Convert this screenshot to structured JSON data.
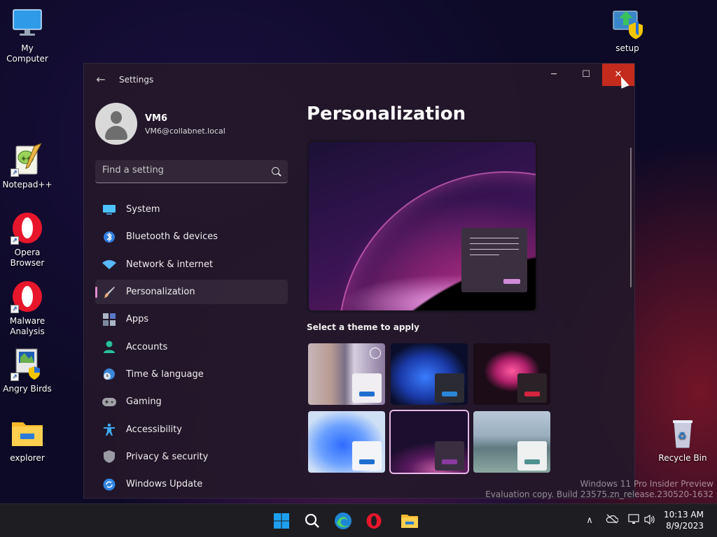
{
  "desktop": {
    "icons": [
      {
        "label": "My Computer",
        "icon": "monitor-icon"
      },
      {
        "label": "setup",
        "icon": "setup-icon"
      },
      {
        "label": "Notepad++",
        "icon": "notepad-plus-plus-icon"
      },
      {
        "label": "Opera Browser",
        "icon": "opera-icon"
      },
      {
        "label": "Malware Analysis",
        "icon": "opera-icon"
      },
      {
        "label": "Angry Birds",
        "icon": "installer-icon"
      },
      {
        "label": "explorer",
        "icon": "folder-icon"
      },
      {
        "label": "Recycle Bin",
        "icon": "recycle-bin-icon"
      }
    ]
  },
  "window": {
    "title": "Settings",
    "controls": {
      "minimize": "─",
      "maximize": "☐",
      "close": "✕"
    }
  },
  "profile": {
    "name": "VM6",
    "email": "VM6@collabnet.local"
  },
  "search": {
    "placeholder": "Find a setting"
  },
  "nav": {
    "items": [
      {
        "label": "System",
        "icon": "system-icon",
        "color": "#4cc2ff"
      },
      {
        "label": "Bluetooth & devices",
        "icon": "bluetooth-icon",
        "color": "#4aa3ff"
      },
      {
        "label": "Network & internet",
        "icon": "wifi-icon",
        "color": "#5bb8ff"
      },
      {
        "label": "Personalization",
        "icon": "brush-icon",
        "color": "#e8a87c",
        "active": true
      },
      {
        "label": "Apps",
        "icon": "apps-icon",
        "color": "#a9b6c7"
      },
      {
        "label": "Accounts",
        "icon": "accounts-icon",
        "color": "#27c29a"
      },
      {
        "label": "Time & language",
        "icon": "globe-clock-icon",
        "color": "#5ab0ff"
      },
      {
        "label": "Gaming",
        "icon": "gamepad-icon",
        "color": "#a0a0a8"
      },
      {
        "label": "Accessibility",
        "icon": "accessibility-icon",
        "color": "#3fa9f5"
      },
      {
        "label": "Privacy & security",
        "icon": "shield-icon",
        "color": "#9a9aa4"
      },
      {
        "label": "Windows Update",
        "icon": "update-icon",
        "color": "#3aa0f0"
      }
    ]
  },
  "content": {
    "title": "Personalization",
    "theme_label": "Select a theme to apply"
  },
  "themes": [
    {
      "name": "theme-custom",
      "swatch": "#f0eef2",
      "bar": "#1f6fd1",
      "selected": false
    },
    {
      "name": "theme-windows-dark",
      "swatch": "#2b2b33",
      "bar": "#2a86d8",
      "selected": false
    },
    {
      "name": "theme-glow",
      "swatch": "#2b2228",
      "bar": "#d4243e",
      "selected": false
    },
    {
      "name": "theme-windows-light",
      "swatch": "#f2f4f8",
      "bar": "#1f6fd1",
      "selected": false
    },
    {
      "name": "theme-captured-motion",
      "swatch": "#3a2f40",
      "bar": "#8a3aa0",
      "selected": true
    },
    {
      "name": "theme-flow",
      "swatch": "#eef1f0",
      "bar": "#4f9090",
      "selected": false
    }
  ],
  "taskbar": {
    "apps": [
      "start-icon",
      "search-icon",
      "edge-icon",
      "opera-icon",
      "file-explorer-icon"
    ],
    "clock": {
      "time": "10:13 AM",
      "date": "8/9/2023"
    }
  },
  "watermark": {
    "line1": "Windows 11 Pro Insider Preview",
    "line2": "Evaluation copy. Build 23575.zn_release.230520-1632"
  }
}
